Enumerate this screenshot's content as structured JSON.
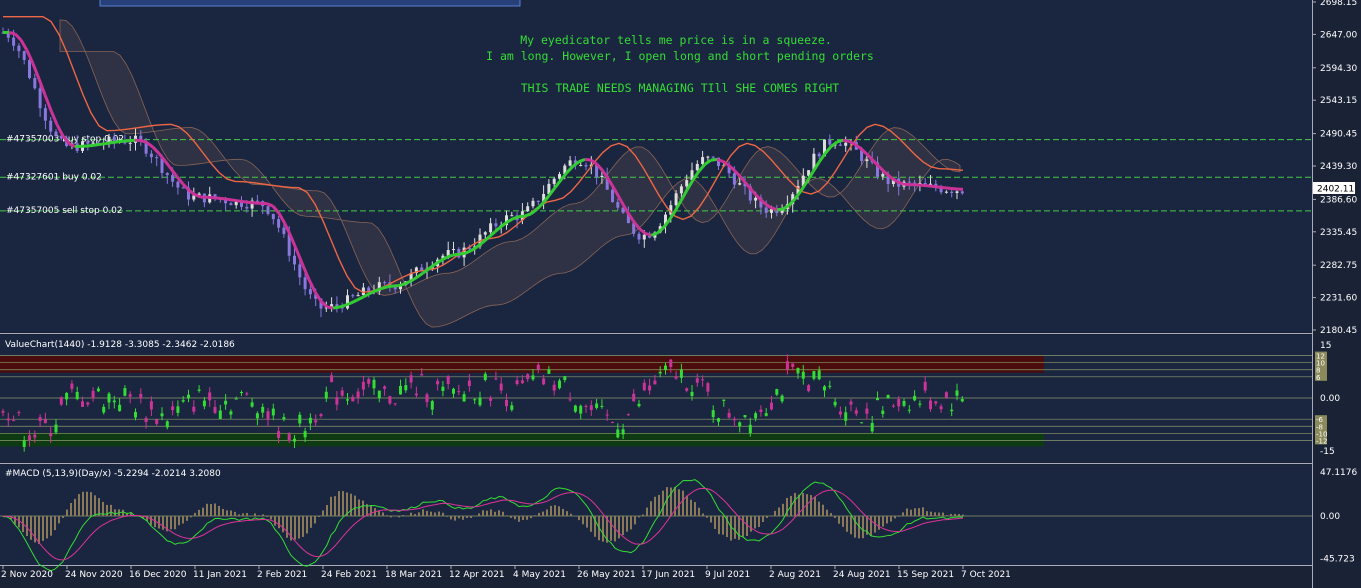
{
  "main": {
    "annotations": [
      "My eyedicator tells me price is in a squeeze.",
      "I am long. However, I open long and short pending orders",
      "THIS TRADE NEEDS MANAGING TIll SHE COMES RIGHT"
    ],
    "orders": [
      {
        "label": "#47357003 buy stop 0.02",
        "price": 2480.9
      },
      {
        "label": "#47327601 buy 0.02",
        "price": 2421.5
      },
      {
        "label": "#47357005 sell stop 0.02",
        "price": 2368.5
      }
    ],
    "current_price": "2402.11",
    "price_axis": [
      "2698.15",
      "2647.00",
      "2594.30",
      "2543.15",
      "2490.45",
      "2439.30",
      "2386.60",
      "2335.45",
      "2282.75",
      "2231.60",
      "2180.45"
    ],
    "price_range": [
      2180.45,
      2698.15
    ]
  },
  "valuechart": {
    "title": "ValueChart(1440) -1.9128 -3.3085 -2.3462 -2.0186",
    "axis": [
      "15",
      "0.00",
      "-15"
    ],
    "level_tags": [
      "12",
      "10",
      "8",
      "6",
      "-6",
      "-8",
      "-10",
      "-12"
    ]
  },
  "macd": {
    "title": "#MACD (5,13,9)(Day/x) -5.2294 -2.0214 3.2080",
    "axis": [
      "47.1176",
      "0.00",
      "-45.723"
    ]
  },
  "time_axis": [
    "2 Nov 2020",
    "24 Nov 2020",
    "16 Dec 2020",
    "11 Jan 2021",
    "2 Feb 2021",
    "24 Feb 2021",
    "18 Mar 2021",
    "12 Apr 2021",
    "4 May 2021",
    "26 May 2021",
    "17 Jun 2021",
    "9 Jul 2021",
    "2 Aug 2021",
    "24 Aug 2021",
    "15 Sep 2021",
    "7 Oct 2021"
  ],
  "chart_data": {
    "type": "line",
    "title": "",
    "xlabel": "",
    "ylabel": "",
    "x": [
      "2 Nov 2020",
      "24 Nov 2020",
      "16 Dec 2020",
      "11 Jan 2021",
      "2 Feb 2021",
      "24 Feb 2021",
      "18 Mar 2021",
      "12 Apr 2021",
      "4 May 2021",
      "26 May 2021",
      "17 Jun 2021",
      "9 Jul 2021",
      "2 Aug 2021",
      "24 Aug 2021",
      "15 Sep 2021",
      "7 Oct 2021"
    ],
    "series": [
      {
        "values": [
          2650,
          2470,
          2480,
          2390,
          2380,
          2215,
          2250,
          2300,
          2360,
          2450,
          2330,
          2450,
          2370,
          2480,
          2410,
          2402
        ]
      }
    ],
    "ylim": [
      2180.45,
      2698.15
    ],
    "colors": {
      "up": "#33dd33",
      "down": "#cc44aa",
      "cloud": "#cc8866",
      "kijun": "#ee6644",
      "tenkan_up": "#33cc33",
      "tenkan_dn": "#cc3399",
      "level": "#44cc44"
    }
  }
}
